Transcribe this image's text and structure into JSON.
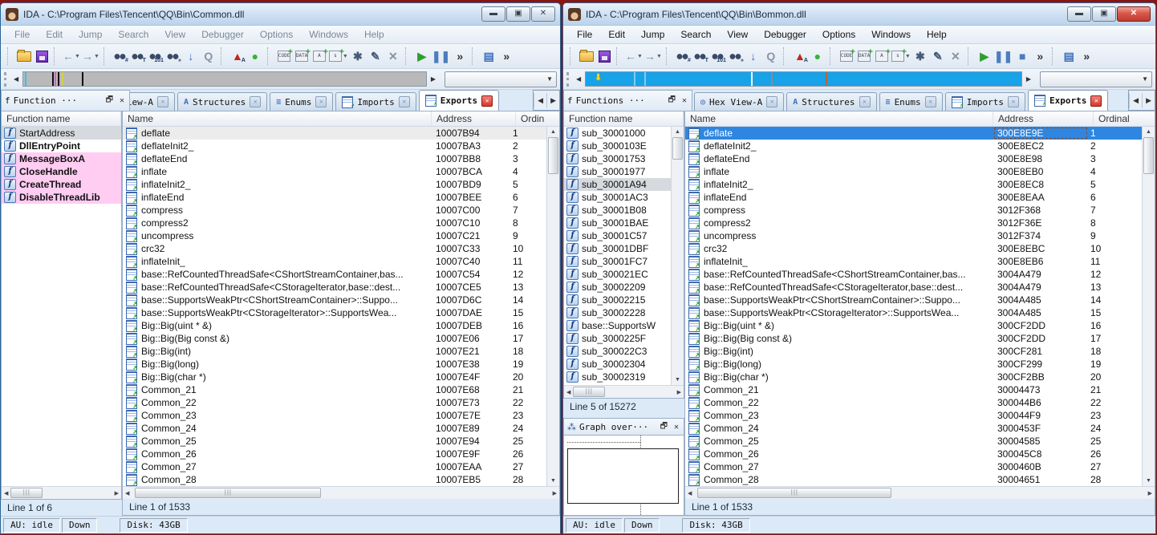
{
  "shared": {
    "menu": [
      "File",
      "Edit",
      "Jump",
      "Search",
      "View",
      "Debugger",
      "Options",
      "Windows",
      "Help"
    ],
    "toolbar": [
      {
        "sep": true
      },
      {
        "name": "open-file-icon",
        "cls": "folder"
      },
      {
        "name": "save-icon",
        "cls": "disk"
      },
      {
        "sep": true
      },
      {
        "name": "back-icon",
        "glyph": "←",
        "color": "#7a8aa8",
        "dd": true
      },
      {
        "name": "forward-icon",
        "glyph": "→",
        "color": "#7a8aa8",
        "dd": true
      },
      {
        "sep": true
      },
      {
        "name": "search-binary-icon",
        "cls": "binoc",
        "badge": "#"
      },
      {
        "name": "search-text-icon",
        "cls": "binoc",
        "badge": "T"
      },
      {
        "name": "search-value-icon",
        "cls": "binoc",
        "badge": "101"
      },
      {
        "name": "search-next-icon",
        "cls": "binoc",
        "badge": "»"
      },
      {
        "name": "jump-down-icon",
        "glyph": "↓",
        "color": "#3a6ebf"
      },
      {
        "name": "search-again-icon",
        "glyph": "Q",
        "color": "#8a94a8"
      },
      {
        "sep": true
      },
      {
        "name": "warning-icon",
        "glyph": "▲",
        "color": "#c42618",
        "badge": "A"
      },
      {
        "name": "analysis-indicator-icon",
        "glyph": "●",
        "color": "#35b335"
      },
      {
        "sep": true
      },
      {
        "name": "add-code-icon",
        "cls": "plus",
        "label": "CODE"
      },
      {
        "name": "add-data-icon",
        "cls": "plus",
        "label": "DATA"
      },
      {
        "name": "add-name-icon",
        "cls": "plus",
        "label": "A"
      },
      {
        "name": "add-string-icon",
        "cls": "plus",
        "label": "s",
        "dd": true
      },
      {
        "name": "add-xref-icon",
        "glyph": "✱",
        "color": "#445a78"
      },
      {
        "name": "edit-icon",
        "glyph": "✎",
        "color": "#445a78"
      },
      {
        "name": "delete-icon",
        "glyph": "✕",
        "color": "#8a94a0"
      },
      {
        "sep": true
      },
      {
        "name": "debug-run-icon",
        "glyph": "▶",
        "color": "#2d9e2d"
      },
      {
        "name": "debug-pause-icon",
        "glyph": "❚❚",
        "color": "#4a7ebd"
      },
      {
        "name": "debug-stop-icon",
        "glyph": "■",
        "color": "#4a7ebd",
        "right_only": true
      },
      {
        "name": "toolbar-overflow-icon",
        "glyph": "»",
        "color": "#333333"
      },
      {
        "sep": true
      },
      {
        "name": "windows-list-icon",
        "glyph": "▤",
        "color": "#3a6ebf"
      },
      {
        "name": "toolbar-overflow2-icon",
        "glyph": "»",
        "color": "#333333"
      }
    ],
    "tab_scroll_left": "◀",
    "tab_scroll_right": "▶",
    "export_names": [
      "deflate",
      "deflateInit2_",
      "deflateEnd",
      "inflate",
      "inflateInit2_",
      "inflateEnd",
      "compress",
      "compress2",
      "uncompress",
      "crc32",
      "inflateInit_",
      "base::RefCountedThreadSafe<CShortStreamContainer,bas...",
      "base::RefCountedThreadSafe<CStorageIterator,base::dest...",
      "base::SupportsWeakPtr<CShortStreamContainer>::Suppo...",
      "base::SupportsWeakPtr<CStorageIterator>::SupportsWea...",
      "Big::Big(uint * &)",
      "Big::Big(Big const &)",
      "Big::Big(int)",
      "Big::Big(long)",
      "Big::Big(char *)",
      "Common_21",
      "Common_22",
      "Common_23",
      "Common_24",
      "Common_25",
      "Common_26",
      "Common_27",
      "Common_28"
    ],
    "ordinals": [
      "1",
      "2",
      "3",
      "4",
      "5",
      "6",
      "7",
      "8",
      "9",
      "10",
      "11",
      "12",
      "13",
      "14",
      "15",
      "16",
      "17",
      "18",
      "19",
      "20",
      "21",
      "22",
      "23",
      "24",
      "25",
      "26",
      "27",
      "28"
    ]
  },
  "left": {
    "title": "IDA - C:\\Program Files\\Tencent\\QQ\\Bin\\Common.dll",
    "active": false,
    "window_buttons": {
      "minimize": "▬",
      "maximize": "▣",
      "close": "✕"
    },
    "nav_marks": [
      {
        "x": "7.2%",
        "color": "#111111"
      },
      {
        "x": "7.8%",
        "color": "#e05ac8"
      },
      {
        "x": "8.6%",
        "color": "#111111"
      },
      {
        "x": "9.6%",
        "color": "#cdd24a"
      },
      {
        "x": "14.5%",
        "color": "#111111"
      }
    ],
    "nav_tick": {
      "x": "0.4%",
      "color": "#35c0ee"
    },
    "fn_panel": {
      "title": "Function ···",
      "restore": "🗗",
      "close": "✕",
      "header": "Function name",
      "items": [
        {
          "label": "StartAddress",
          "style": "current"
        },
        {
          "label": "DllEntryPoint",
          "style": "bold"
        },
        {
          "label": "MessageBoxA",
          "style": "bold library"
        },
        {
          "label": "CloseHandle",
          "style": "bold library"
        },
        {
          "label": "CreateThread",
          "style": "bold library"
        },
        {
          "label": "DisableThreadLib",
          "style": "bold library"
        }
      ]
    },
    "tabs": [
      {
        "label": "x View-A",
        "icon": "hex-view-icon",
        "glyph": "◎",
        "clipped": true
      },
      {
        "label": "Structures",
        "icon": "structures-icon",
        "glyph": "A"
      },
      {
        "label": "Enums",
        "icon": "enums-icon",
        "glyph": "≡"
      },
      {
        "label": "Imports",
        "icon": "imports-icon",
        "glyph": ""
      },
      {
        "label": "Exports",
        "icon": "exports-icon",
        "glyph": "",
        "active": true
      }
    ],
    "exports": {
      "columns": {
        "name": "Name",
        "addr": "Address",
        "ord": "Ordin"
      },
      "addresses": [
        "10007B94",
        "10007BA3",
        "10007BB8",
        "10007BCA",
        "10007BD9",
        "10007BEE",
        "10007C00",
        "10007C10",
        "10007C21",
        "10007C33",
        "10007C40",
        "10007C54",
        "10007CE5",
        "10007D6C",
        "10007DAE",
        "10007DEB",
        "10007E06",
        "10007E21",
        "10007E38",
        "10007E4F",
        "10007E68",
        "10007E73",
        "10007E7E",
        "10007E89",
        "10007E94",
        "10007E9F",
        "10007EAA",
        "10007EB5"
      ],
      "current_row": 0,
      "selected_row": -1
    },
    "lines": {
      "functions": "Line 1 of 6",
      "exports": "Line 1 of 1533"
    },
    "status": {
      "au": "AU:  idle",
      "dir": "Down",
      "disk": "Disk: 43GB"
    }
  },
  "right": {
    "title": "IDA - C:\\Program Files\\Tencent\\QQ\\Bin\\Bommon.dll",
    "active": true,
    "window_buttons": {
      "minimize": "▬",
      "maximize": "▣",
      "close": "✕"
    },
    "nav_cursor": {
      "x": "2.0%",
      "glyph": "⬇"
    },
    "nav_marks": [
      {
        "x": "11%",
        "color": "#7fcdf2"
      },
      {
        "x": "13.5%",
        "color": "#7fcdf2"
      },
      {
        "x": "38%",
        "color": "#ffffff"
      },
      {
        "x": "42.5%",
        "color": "#8a8a8a"
      },
      {
        "x": "55%",
        "color": "#b06a3a"
      }
    ],
    "fn_panel": {
      "title": "Functions ···",
      "restore": "🗗",
      "close": "✕",
      "header": "Function name",
      "items": [
        {
          "label": "sub_30001000",
          "style": ""
        },
        {
          "label": "sub_3000103E",
          "style": ""
        },
        {
          "label": "sub_30001753",
          "style": ""
        },
        {
          "label": "sub_30001977",
          "style": ""
        },
        {
          "label": "sub_30001A94",
          "style": "current"
        },
        {
          "label": "sub_30001AC3",
          "style": ""
        },
        {
          "label": "sub_30001B08",
          "style": ""
        },
        {
          "label": "sub_30001BAE",
          "style": ""
        },
        {
          "label": "sub_30001C57",
          "style": ""
        },
        {
          "label": "sub_30001DBF",
          "style": ""
        },
        {
          "label": "sub_30001FC7",
          "style": ""
        },
        {
          "label": "sub_300021EC",
          "style": ""
        },
        {
          "label": "sub_30002209",
          "style": ""
        },
        {
          "label": "sub_30002215",
          "style": ""
        },
        {
          "label": "sub_30002228",
          "style": ""
        },
        {
          "label": "base::SupportsW",
          "style": ""
        },
        {
          "label": "sub_3000225F",
          "style": ""
        },
        {
          "label": "sub_300022C3",
          "style": ""
        },
        {
          "label": "sub_30002304",
          "style": ""
        },
        {
          "label": "sub_30002319",
          "style": ""
        }
      ]
    },
    "tabs": [
      {
        "label": "Hex View-A",
        "icon": "hex-view-icon",
        "glyph": "◎"
      },
      {
        "label": "Structures",
        "icon": "structures-icon",
        "glyph": "A"
      },
      {
        "label": "Enums",
        "icon": "enums-icon",
        "glyph": "≡"
      },
      {
        "label": "Imports",
        "icon": "imports-icon",
        "glyph": ""
      },
      {
        "label": "Exports",
        "icon": "exports-icon",
        "glyph": "",
        "active": true
      }
    ],
    "exports": {
      "columns": {
        "name": "Name",
        "addr": "Address",
        "ord": "Ordinal"
      },
      "addresses": [
        "300E8E9E",
        "300E8EC2",
        "300E8E98",
        "300E8EB0",
        "300E8EC8",
        "300E8EAA",
        "3012F368",
        "3012F36E",
        "3012F374",
        "300E8EBC",
        "300E8EB6",
        "3004A479",
        "3004A479",
        "3004A485",
        "3004A485",
        "300CF2DD",
        "300CF2DD",
        "300CF281",
        "300CF299",
        "300CF2BB",
        "30004473",
        "300044B6",
        "300044F9",
        "3000453F",
        "30004585",
        "300045C8",
        "3000460B",
        "30004651"
      ],
      "current_row": -1,
      "selected_row": 0
    },
    "graph": {
      "title": "Graph over···",
      "icon": "graph-overview-icon",
      "restore": "🗗",
      "close": "✕"
    },
    "lines": {
      "functions": "Line 5 of 15272",
      "exports": "Line 1 of 1533"
    },
    "status": {
      "au": "AU:  idle",
      "dir": "Down",
      "disk": "Disk: 43GB"
    }
  }
}
